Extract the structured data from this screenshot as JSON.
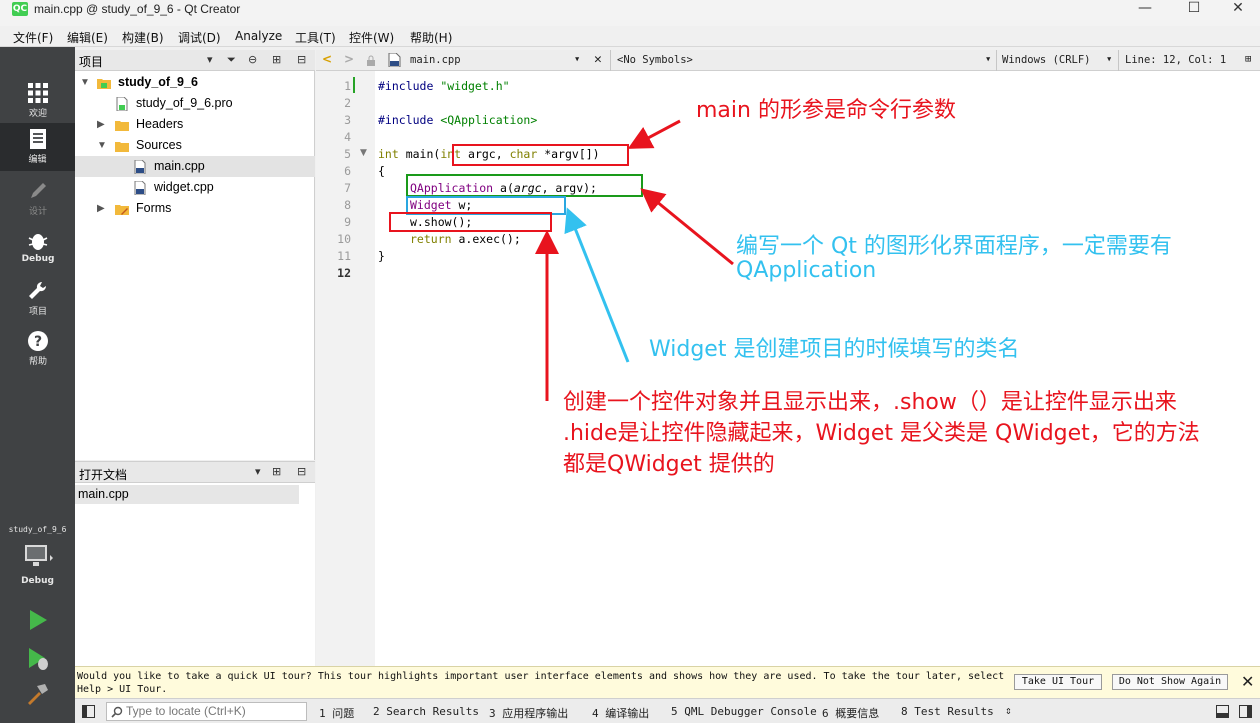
{
  "window": {
    "title": "main.cpp @ study_of_9_6 - Qt Creator",
    "app_icon": "QC",
    "minimize": "—",
    "maximize": "☐",
    "close": "✕"
  },
  "menu": [
    "文件(F)",
    "编辑(E)",
    "构建(B)",
    "调试(D)",
    "Analyze",
    "工具(T)",
    "控件(W)",
    "帮助(H)"
  ],
  "modes": [
    {
      "label": "欢迎",
      "icon": "grid-icon"
    },
    {
      "label": "编辑",
      "icon": "edit-icon"
    },
    {
      "label": "设计",
      "icon": "pencil-icon"
    },
    {
      "label": "Debug",
      "icon": "bug-icon"
    },
    {
      "label": "项目",
      "icon": "wrench-icon"
    },
    {
      "label": "帮助",
      "icon": "help-icon"
    }
  ],
  "kit": {
    "name": "study_of_9_6",
    "label": "Debug"
  },
  "project_pane": {
    "title": "项目",
    "tree": [
      {
        "label": "study_of_9_6",
        "type": "project"
      },
      {
        "label": "study_of_9_6.pro",
        "type": "pro-file"
      },
      {
        "label": "Headers",
        "type": "folder"
      },
      {
        "label": "Sources",
        "type": "folder"
      },
      {
        "label": "main.cpp",
        "type": "cpp-file"
      },
      {
        "label": "widget.cpp",
        "type": "cpp-file"
      },
      {
        "label": "Forms",
        "type": "folder"
      }
    ]
  },
  "open_docs": {
    "title": "打开文档",
    "items": [
      "main.cpp"
    ]
  },
  "editor_toolbar": {
    "file": "main.cpp",
    "symbols": "<No Symbols>",
    "line_ending": "Windows (CRLF)",
    "position": "Line: 12, Col: 1"
  },
  "code": {
    "line_numbers": [
      "1",
      "2",
      "3",
      "4",
      "5",
      "6",
      "7",
      "8",
      "9",
      "10",
      "11",
      "12"
    ],
    "lines": {
      "l1_pp": "#include ",
      "l1_str": "\"widget.h\"",
      "l3_pp": "#include ",
      "l3_str": "<QApplication>",
      "l5_kw1": "int",
      "l5_a": " main(",
      "l5_kw2": "int",
      "l5_b": " argc, ",
      "l5_kw3": "char",
      "l5_c": " *argv[])",
      "l6": "{",
      "l7_cls": "QApplication",
      "l7_a": " a(",
      "l7_it": "argc",
      "l7_b": ", argv);",
      "l8_cls": "Widget",
      "l8_a": " w;",
      "l9": "w.show();",
      "l10_kw": "return",
      "l10_a": " a.exec();",
      "l11": "}"
    }
  },
  "annotations": {
    "main_args": "main 的形参是命令行参数",
    "qapp_line1": "编写一个 Qt 的图形化界面程序，一定需要有",
    "qapp_line2": "QApplication",
    "widget_note": "Widget 是创建项目的时候填写的类名",
    "show_line1": "创建一个控件对象并且显示出来，.show（）是让控件显示出来",
    "show_line2": ".hide是让控件隐藏起来，Widget 是父类是 QWidget，它的方法",
    "show_line3": "都是QWidget 提供的",
    "colors": {
      "red": "#e8141e",
      "cyan": "#33c1ef",
      "green": "#1a9a1a",
      "blue": "#2aa7e0"
    }
  },
  "tour": {
    "text": "Would you like to take a quick UI tour? This tour highlights important user interface elements and shows how they are used. To take the tour later, select Help > UI Tour.",
    "take_button": "Take UI Tour",
    "dismiss_button": "Do Not Show Again"
  },
  "statusbar": {
    "locator_placeholder": "Type to locate (Ctrl+K)",
    "tabs": [
      "1 问题",
      "2 Search Results",
      "3 应用程序输出",
      "4 编译输出",
      "5 QML Debugger Console",
      "6 概要信息",
      "8 Test Results"
    ]
  }
}
